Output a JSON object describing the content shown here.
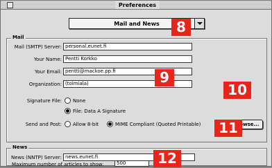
{
  "window": {
    "title": "Preferences"
  },
  "panel_select": {
    "selected": "Mail and News"
  },
  "mail": {
    "group_title": "Mail",
    "smtp_label": "Mail (SMTP) Server:",
    "smtp_value": "personal.eunet.fi",
    "name_label": "Your Name:",
    "name_value": "Pentti Korkko",
    "email_label": "Your Email:",
    "email_value": "pentti@mackoe.pp.fi",
    "org_label": "Organization:",
    "org_value": "(toimiala)",
    "sigfile_label": "Signature File:",
    "sig_none": "None",
    "sig_file": "File: Data A Signature",
    "browse_label": "Browse...",
    "send_post_label": "Send and Post:",
    "allow_8bit": "Allow 8-bit",
    "mime_compliant": "MIME Compliant (Quoted Printable)"
  },
  "news": {
    "group_title": "News",
    "nntp_label": "News (NNTP) Server:",
    "nntp_value": "news.eunet.fi",
    "max_label": "Maximum number of articles to show:",
    "max_value": "500"
  },
  "callouts": [
    "8",
    "9",
    "10",
    "11",
    "12"
  ],
  "colors": {
    "callout": "#e6251b",
    "window_bg": "#dcdcdc"
  }
}
